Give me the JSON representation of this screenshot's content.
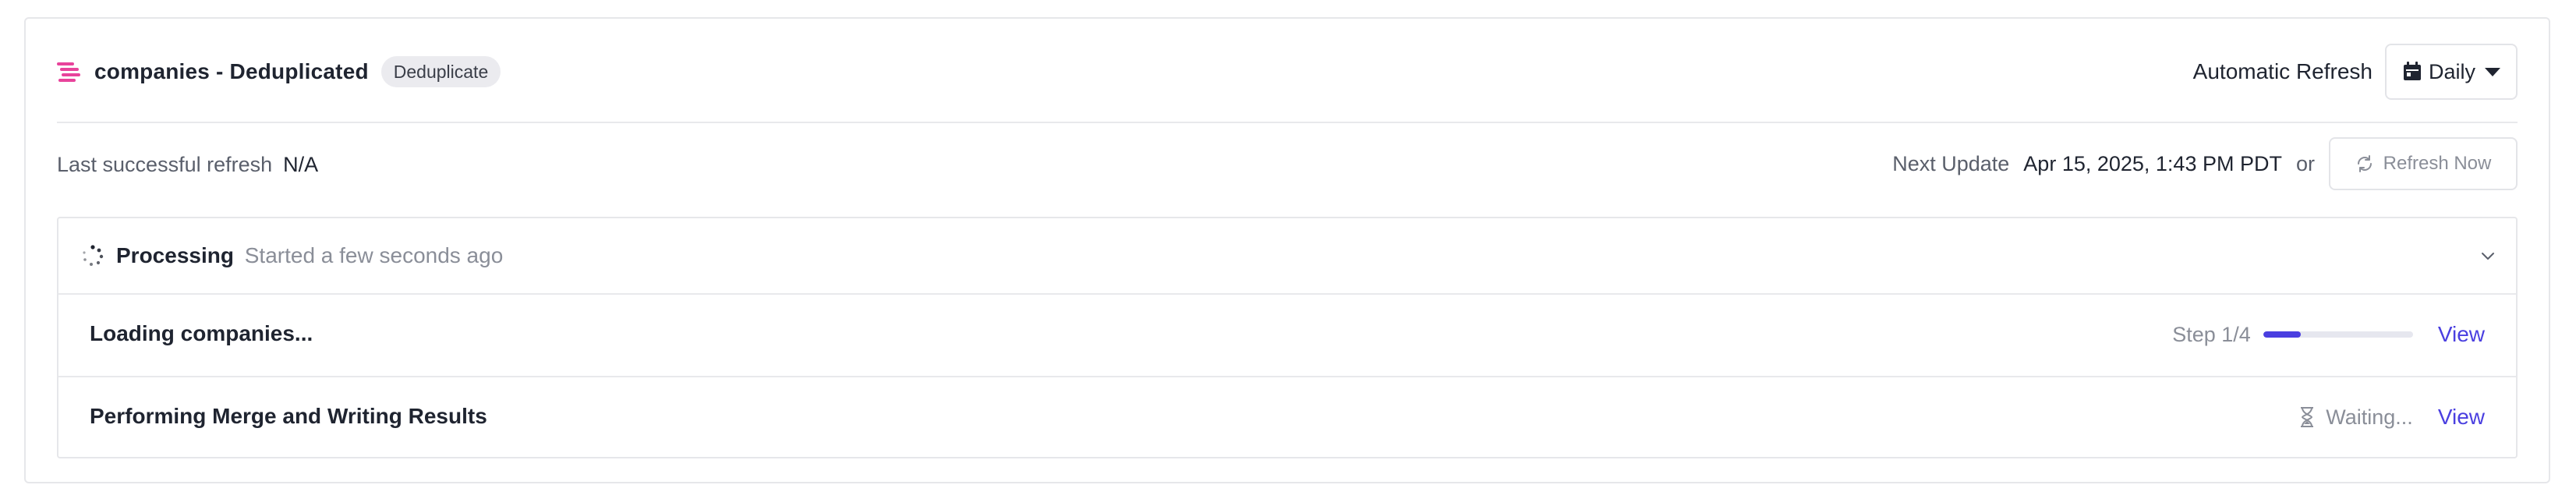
{
  "header": {
    "title": "companies - Deduplicated",
    "badge": "Deduplicate",
    "auto_refresh_label": "Automatic Refresh",
    "frequency": "Daily"
  },
  "refresh": {
    "last_label": "Last successful refresh",
    "last_value": "N/A",
    "next_label": "Next Update",
    "next_value": "Apr 15, 2025, 1:43 PM PDT",
    "or": "or",
    "refresh_button": "Refresh Now"
  },
  "processing": {
    "title": "Processing",
    "subtitle": "Started a few seconds ago",
    "steps": [
      {
        "name": "Loading companies...",
        "status": "Step 1/4",
        "progress": 0.25,
        "action": "View"
      },
      {
        "name": "Performing Merge and Writing Results",
        "status": "Waiting...",
        "action": "View"
      }
    ]
  },
  "colors": {
    "accent": "#4a3fe0",
    "logo": "#e8439b"
  },
  "icons": [
    "logo-icon",
    "calendar-icon",
    "caret-down-icon",
    "refresh-icon",
    "spinner-icon",
    "chevron-down-icon",
    "hourglass-icon"
  ]
}
